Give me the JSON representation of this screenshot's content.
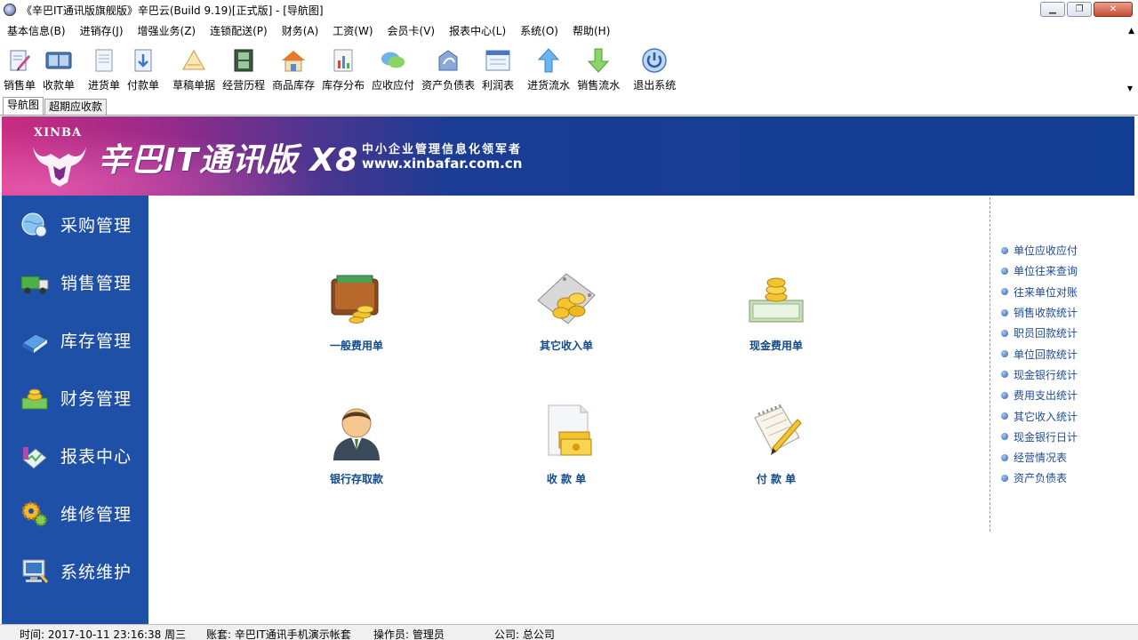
{
  "window": {
    "title": "《辛巴IT通讯版旗舰版》辛巴云(Build 9.19)[正式版] - [导航图]",
    "buttons": {
      "minimize": "▁",
      "restore": "❐",
      "close": "✕"
    }
  },
  "menubar": {
    "items": [
      "基本信息(B)",
      "进销存(J)",
      "增强业务(Z)",
      "连锁配送(P)",
      "财务(A)",
      "工资(W)",
      "会员卡(V)",
      "报表中心(L)",
      "系统(O)",
      "帮助(H)"
    ],
    "collapse_glyph": "▲"
  },
  "toolbar": {
    "items": [
      {
        "label": "销售单",
        "icon": "sales-order-icon"
      },
      {
        "label": "收款单",
        "icon": "receipt-icon"
      },
      {
        "label": "进货单",
        "icon": "purchase-order-icon"
      },
      {
        "label": "付款单",
        "icon": "payment-icon"
      },
      {
        "label": "草稿单据",
        "icon": "draft-icon"
      },
      {
        "label": "经营历程",
        "icon": "film-icon"
      },
      {
        "label": "商品库存",
        "icon": "house-icon"
      },
      {
        "label": "库存分布",
        "icon": "bar-chart-icon"
      },
      {
        "label": "应收应付",
        "icon": "chat-bubbles-icon"
      },
      {
        "label": "资产负债表",
        "icon": "balance-sheet-icon"
      },
      {
        "label": "利润表",
        "icon": "window-icon"
      },
      {
        "label": "进货流水",
        "icon": "arrow-up-icon"
      },
      {
        "label": "销售流水",
        "icon": "arrow-down-icon"
      },
      {
        "label": "退出系统",
        "icon": "power-icon"
      }
    ],
    "more_glyph": "▼"
  },
  "tabs": [
    {
      "label": "导航图",
      "active": true
    },
    {
      "label": "超期应收款",
      "active": false
    }
  ],
  "banner": {
    "logo_text": "XINBA",
    "product": "辛巴IT通讯版 X8",
    "slogan": "中小企业管理信息化领军者",
    "url": "www.xinbafar.com.cn"
  },
  "leftnav": {
    "items": [
      {
        "label": "采购管理",
        "icon": "purchase-globe-icon"
      },
      {
        "label": "销售管理",
        "icon": "truck-icon"
      },
      {
        "label": "库存管理",
        "icon": "books-icon"
      },
      {
        "label": "财务管理",
        "icon": "coins-icon"
      },
      {
        "label": "报表中心",
        "icon": "report-icon"
      },
      {
        "label": "维修管理",
        "icon": "gears-icon"
      },
      {
        "label": "系统维护",
        "icon": "computer-icon"
      }
    ]
  },
  "main": {
    "tiles": [
      {
        "label": "一般费用单",
        "icon": "wallet-icon"
      },
      {
        "label": "其它收入单",
        "icon": "coin-plate-icon"
      },
      {
        "label": "现金费用单",
        "icon": "cash-stack-icon"
      },
      {
        "label": "银行存取款",
        "icon": "banker-icon"
      },
      {
        "label": "收 款 单",
        "icon": "receipt-money-icon"
      },
      {
        "label": "付 款 单",
        "icon": "notepad-icon"
      }
    ]
  },
  "rightlinks": [
    "单位应收应付",
    "单位往来查询",
    "往来单位对账",
    "销售收款统计",
    "职员回款统计",
    "单位回款统计",
    "现金银行统计",
    "费用支出统计",
    "其它收入统计",
    "现金银行日计",
    "经营情况表",
    "资产负债表"
  ],
  "statusbar": {
    "time_label": "时间: 2017-10-11 23:16:38 周三",
    "account_label": "账套: 辛巴IT通讯手机演示帐套",
    "operator_label": "操作员: 管理员",
    "company_label": "公司: 总公司"
  },
  "colors": {
    "nav_blue": "#1e50a8",
    "link_blue": "#1e4a90",
    "tile_label": "#124a8c"
  }
}
